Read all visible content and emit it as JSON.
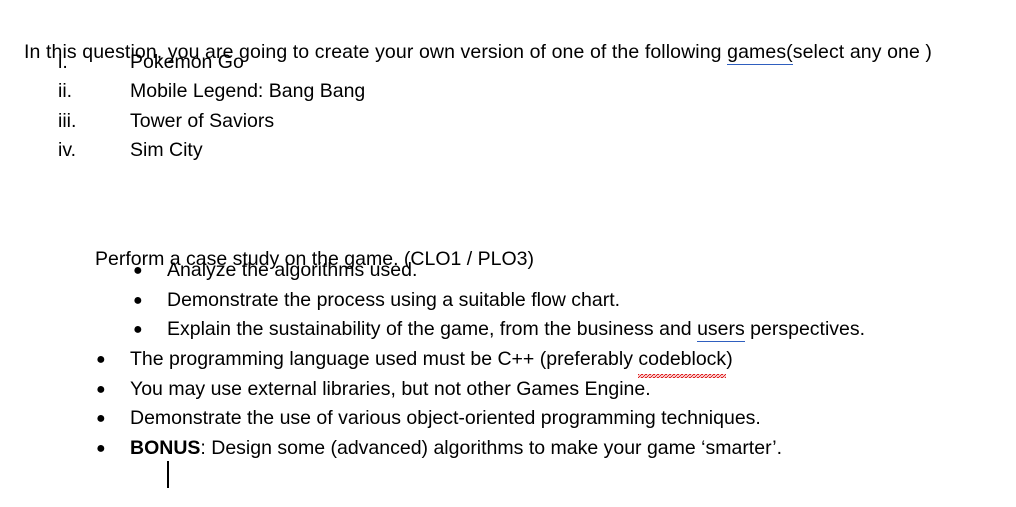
{
  "document": {
    "intro": {
      "before": "In this question, you are going to create your own version of one of the following ",
      "flagged_word": "games(",
      "after": "select any one )",
      "flag_type": "grammar",
      "flag_color": "#2f5fbf"
    },
    "games_list": [
      {
        "marker": "i.",
        "title": "Pokemon Go"
      },
      {
        "marker": "ii.",
        "title": "Mobile Legend: Bang Bang"
      },
      {
        "marker": "iii.",
        "title": "Tower of Saviors"
      },
      {
        "marker": "iv.",
        "title": "Sim City"
      }
    ],
    "case_study": {
      "heading": "Perform a case study on the game. (CLO1 / PLO3)",
      "sub_bullets": [
        {
          "text": "Analyze the algorithms used."
        },
        {
          "text": "Demonstrate the process using a suitable flow chart."
        },
        {
          "before": "Explain the sustainability of the game, from the business and ",
          "flagged_word": "users",
          "after": " perspectives.",
          "flag_type": "grammar",
          "flag_color": "#2f5fbf"
        }
      ]
    },
    "requirements": [
      {
        "before": "The programming language used must be C++ (preferably ",
        "flagged_word": "codeblock",
        "after": ")",
        "flag_type": "spelling",
        "flag_color": "#e02020"
      },
      {
        "text": "You may use external libraries, but not other Games Engine."
      },
      {
        "text": "Demonstrate the use of various object-oriented programming techniques."
      },
      {
        "bold_lead": "BONUS",
        "text": ": Design some (advanced) algorithms to make your game ‘smarter’."
      }
    ],
    "bullet_glyph": "●",
    "caret_visible": true,
    "background_color": "#ffffff",
    "text_color": "#000000"
  }
}
